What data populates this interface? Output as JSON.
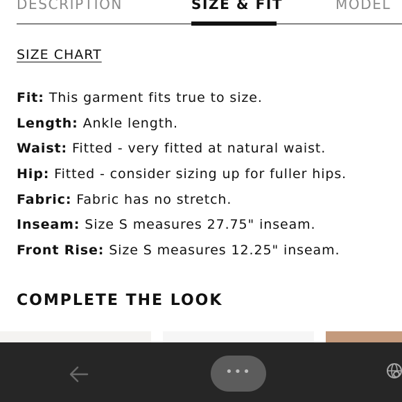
{
  "tabs": {
    "description": "DESCRIPTION",
    "size_fit": "SIZE & FIT",
    "model": "MODEL"
  },
  "size_chart_link": "SIZE CHART",
  "specs": [
    {
      "label": "Fit:",
      "value": "This garment fits true to size."
    },
    {
      "label": "Length:",
      "value": "Ankle length."
    },
    {
      "label": "Waist:",
      "value": "Fitted - very fitted at natural waist."
    },
    {
      "label": "Hip:",
      "value": "Fitted - consider sizing up for fuller hips."
    },
    {
      "label": "Fabric:",
      "value": "Fabric has no stretch."
    },
    {
      "label": "Inseam:",
      "value": "Size S measures 27.75\" inseam."
    },
    {
      "label": "Front Rise:",
      "value": "Size S measures 12.25\" inseam."
    }
  ],
  "complete_the_look": "COMPLETE THE LOOK",
  "bottom_bar": {
    "more_label": "•••",
    "back_icon": "arrow-left-icon",
    "right_icon": "globe-search-icon"
  },
  "colors": {
    "text": "#111111",
    "tab_inactive": "#8a8a8a",
    "bottom_bar": "#262626",
    "more_pill": "#5c5c5c"
  }
}
